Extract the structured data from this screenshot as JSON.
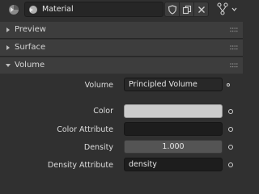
{
  "header": {
    "material_name": "Material",
    "icons": [
      "material-sphere-icon",
      "material-slot-sphere-icon",
      "shield-icon",
      "duplicate-icon",
      "close-icon",
      "node-tree-icon"
    ]
  },
  "panels": [
    {
      "label": "Preview",
      "expanded": false
    },
    {
      "label": "Surface",
      "expanded": false
    },
    {
      "label": "Volume",
      "expanded": true
    }
  ],
  "volume": {
    "volume_label": "Volume",
    "volume_value": "Principled Volume",
    "color_label": "Color",
    "color_swatch": "#cccccc",
    "color_attr_label": "Color Attribute",
    "color_attr_value": "",
    "density_label": "Density",
    "density_value": "1.000",
    "density_attr_label": "Density Attribute",
    "density_attr_value": "density"
  }
}
